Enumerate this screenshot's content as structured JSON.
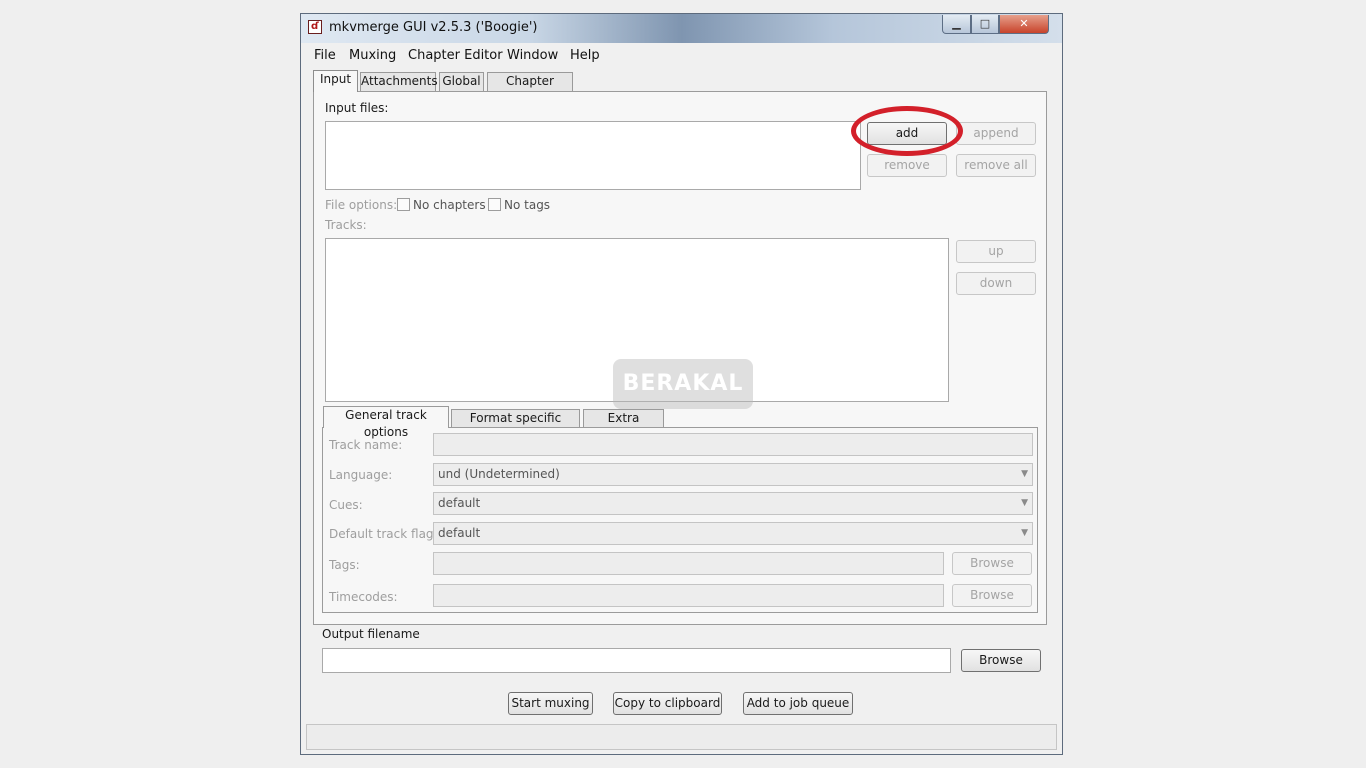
{
  "window": {
    "title": "mkvmerge GUI v2.5.3 ('Boogie')",
    "controls": {
      "minimize": "▁",
      "maximize": "□",
      "close": "✕"
    }
  },
  "menu": [
    "File",
    "Muxing",
    "Chapter Editor",
    "Window",
    "Help"
  ],
  "tabs": [
    "Input",
    "Attachments",
    "Global",
    "Chapter Editor"
  ],
  "input": {
    "input_files_label": "Input files:",
    "buttons": {
      "add": "add",
      "append": "append",
      "remove": "remove",
      "remove_all": "remove all"
    },
    "file_options_label": "File options:",
    "no_chapters": "No chapters",
    "no_tags": "No tags",
    "tracks_label": "Tracks:",
    "up": "up",
    "down": "down"
  },
  "subtabs": [
    "General track options",
    "Format specific options",
    "Extra options"
  ],
  "general": {
    "track_name_label": "Track name:",
    "language_label": "Language:",
    "language_value": "und (Undetermined)",
    "cues_label": "Cues:",
    "cues_value": "default",
    "default_flag_label": "Default track flag:",
    "default_flag_value": "default",
    "tags_label": "Tags:",
    "timecodes_label": "Timecodes:",
    "browse": "Browse"
  },
  "output": {
    "label": "Output filename",
    "browse": "Browse"
  },
  "actions": {
    "start": "Start muxing",
    "copy": "Copy to clipboard",
    "queue": "Add to job queue"
  },
  "watermark": "BERAKAL",
  "colors": {
    "highlight_ring": "#d3202a",
    "close_button": "#c8432b"
  }
}
